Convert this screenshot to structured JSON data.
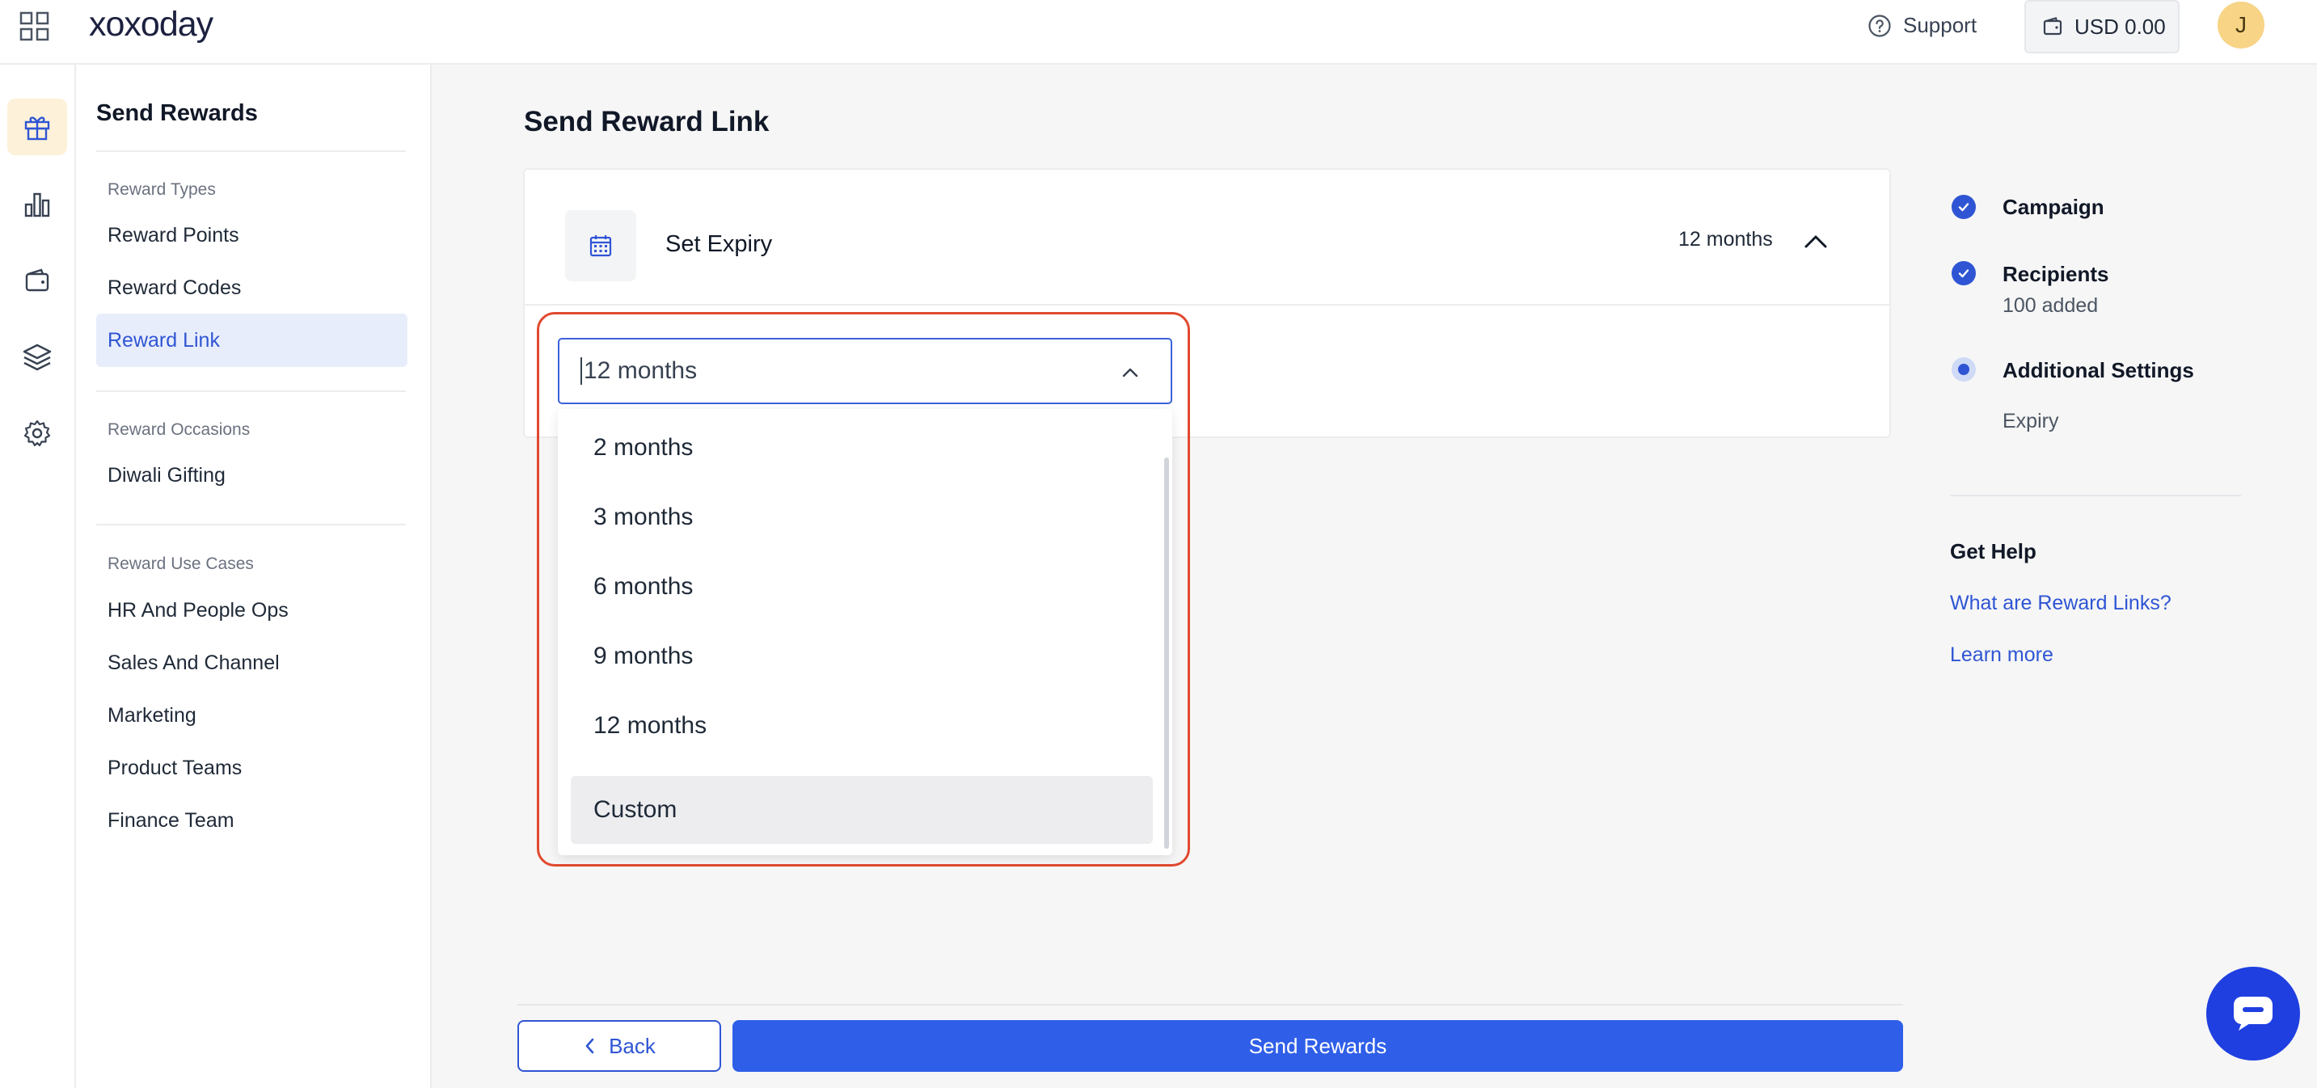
{
  "header": {
    "logo_text": "xoxoday",
    "support_label": "Support",
    "wallet_balance": "USD 0.00",
    "avatar_initial": "J"
  },
  "rail": {
    "items": [
      {
        "icon": "gift-icon",
        "active": true
      },
      {
        "icon": "bar-chart-icon",
        "active": false
      },
      {
        "icon": "wallet-icon",
        "active": false
      },
      {
        "icon": "layers-icon",
        "active": false
      },
      {
        "icon": "gear-icon",
        "active": false
      }
    ]
  },
  "subnav": {
    "title": "Send Rewards",
    "sections": [
      {
        "label": "Reward Types",
        "items": [
          "Reward Points",
          "Reward Codes",
          "Reward Link"
        ]
      },
      {
        "label": "Reward Occasions",
        "items": [
          "Diwali Gifting"
        ]
      },
      {
        "label": "Reward Use Cases",
        "items": [
          "HR And People Ops",
          "Sales And Channel",
          "Marketing",
          "Product Teams",
          "Finance Team"
        ]
      }
    ],
    "active_item": "Reward Link"
  },
  "main": {
    "title": "Send Reward Link",
    "expiry_card": {
      "heading": "Set Expiry",
      "current_value": "12 months",
      "select_value": "12 months",
      "options": [
        "2 months",
        "3 months",
        "6 months",
        "9 months",
        "12 months",
        "Custom"
      ],
      "hovered_option": "Custom"
    }
  },
  "steps": [
    {
      "label": "Campaign",
      "status": "done",
      "sub": ""
    },
    {
      "label": "Recipients",
      "status": "done",
      "sub": "100 added"
    },
    {
      "label": "Additional Settings",
      "status": "current",
      "sub": "Expiry"
    }
  ],
  "help": {
    "title": "Get Help",
    "links": [
      "What are Reward Links?",
      "Learn more"
    ]
  },
  "footer": {
    "back_label": "Back",
    "send_label": "Send Rewards"
  },
  "colors": {
    "accent": "#2f55d4",
    "highlight_border": "#e0492f",
    "avatar_bg": "#f7d486"
  }
}
